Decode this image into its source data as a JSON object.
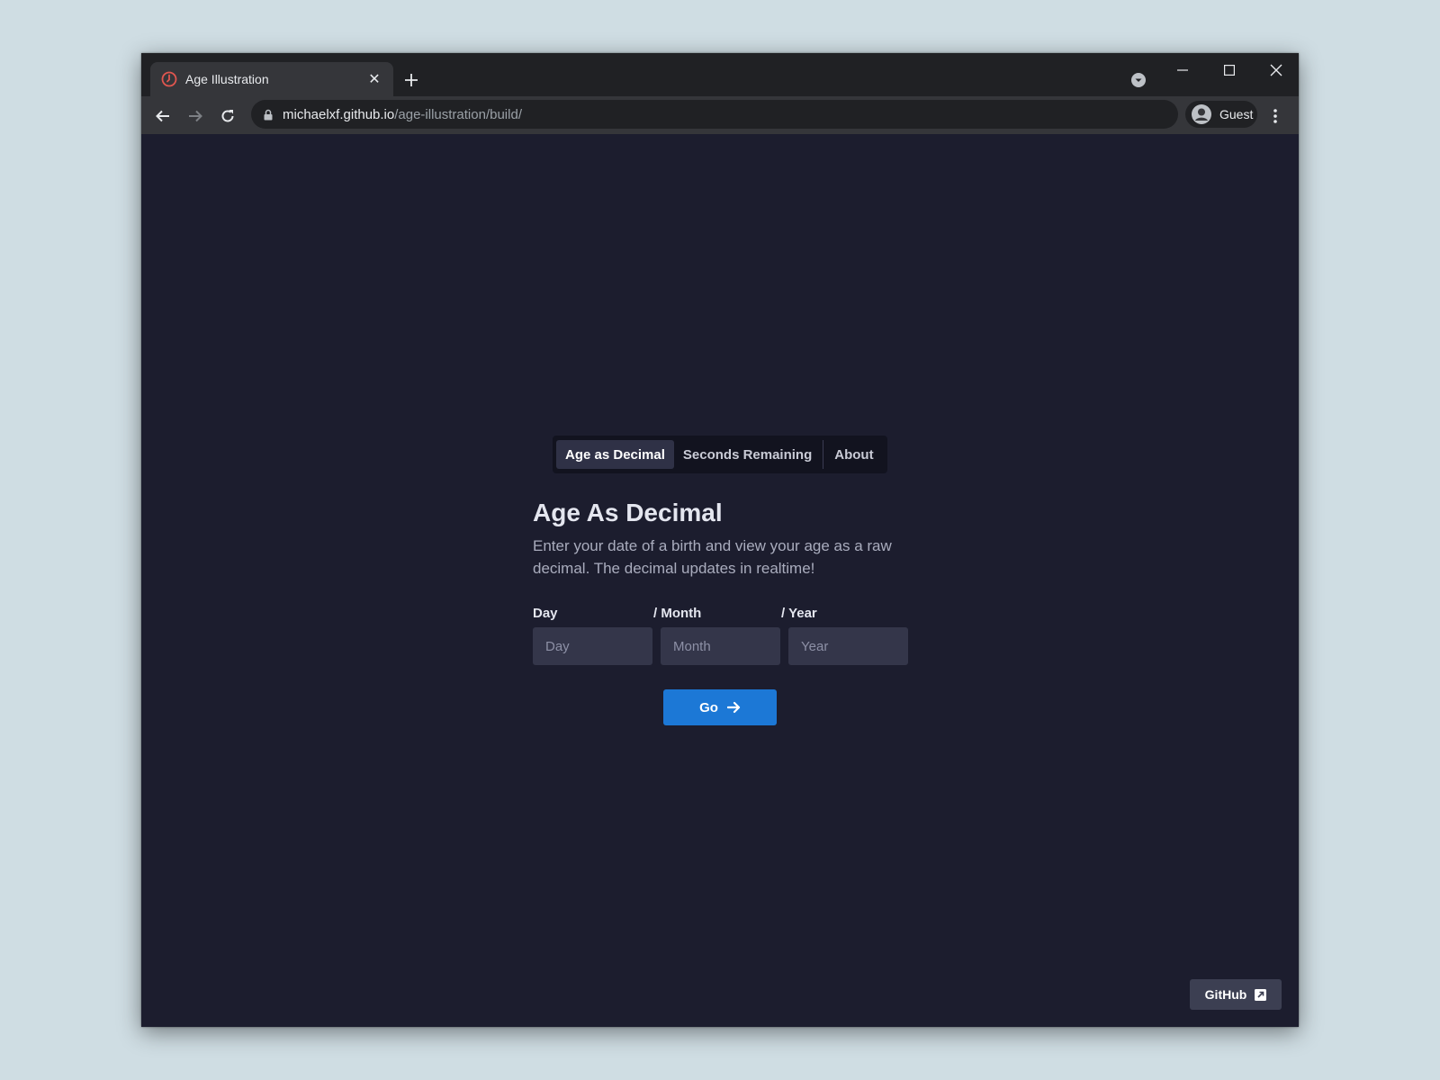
{
  "browser": {
    "tab_title": "Age Illustration",
    "url_host": "michaelxf.github.io",
    "url_path": "/age-illustration/build/",
    "profile_label": "Guest"
  },
  "nav": {
    "tabs": [
      {
        "label": "Age as Decimal",
        "active": true
      },
      {
        "label": "Seconds Remaining",
        "active": false
      },
      {
        "label": "About",
        "active": false
      }
    ]
  },
  "main": {
    "title": "Age As Decimal",
    "description": "Enter your date of a birth and view your age as a raw decimal. The decimal updates in realtime!",
    "fields": {
      "day": {
        "label": "Day",
        "placeholder": "Day",
        "value": ""
      },
      "month": {
        "label": "/ Month",
        "placeholder": "Month",
        "value": ""
      },
      "year": {
        "label": "/ Year",
        "placeholder": "Year",
        "value": ""
      }
    },
    "go_label": "Go"
  },
  "footer": {
    "github_label": "GitHub"
  },
  "colors": {
    "page_bg": "#1c1d2e",
    "accent": "#1c78d6",
    "input_bg": "#34364a"
  }
}
